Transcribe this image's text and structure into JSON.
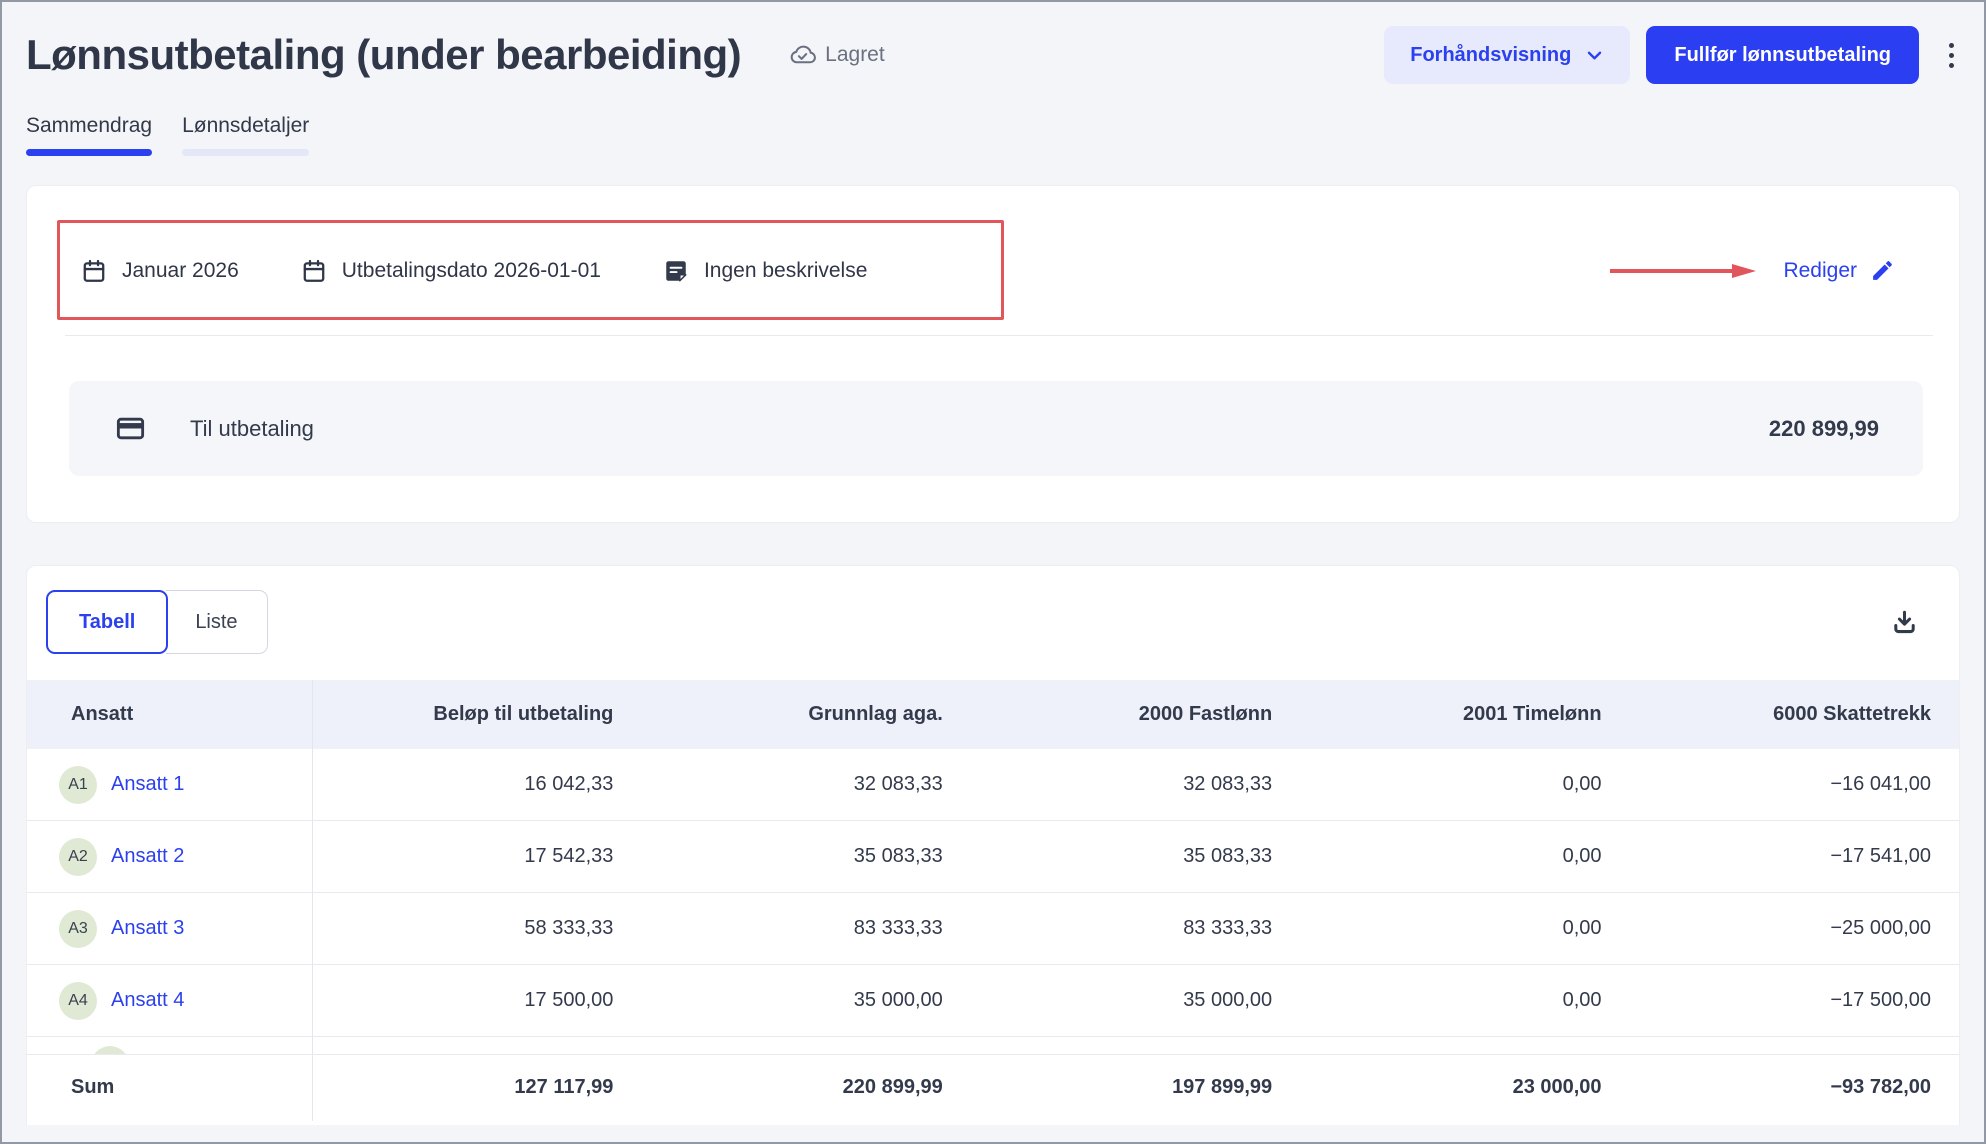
{
  "colors": {
    "accent_blue": "#2b40ee",
    "button_blue": "#2b3ef2",
    "annotation_red": "#e0565b",
    "avatar_green": "#dfe9d4",
    "header_row_bg": "#eef1fa",
    "page_bg": "#f4f5f9"
  },
  "header": {
    "title": "Lønnsutbetaling (under bearbeiding)",
    "saved_label": "Lagret",
    "preview_button_label": "Forhåndsvisning",
    "complete_button_label": "Fullfør lønnsutbetaling"
  },
  "tabs": {
    "summary": "Sammendrag",
    "details": "Lønnsdetaljer"
  },
  "period_card": {
    "period": "Januar 2026",
    "payment_date": "Utbetalingsdato 2026-01-01",
    "description": "Ingen beskrivelse",
    "edit_link": "Rediger",
    "payout_label": "Til utbetaling",
    "payout_amount": "220 899,99"
  },
  "table_card": {
    "toggle": {
      "table": "Tabell",
      "list": "Liste"
    },
    "columns": [
      "Ansatt",
      "Beløp til utbetaling",
      "Grunnlag aga.",
      "2000 Fastlønn",
      "2001 Timelønn",
      "6000 Skattetrekk"
    ],
    "rows": [
      {
        "avatar": "A1",
        "name": "Ansatt 1",
        "values": [
          "16 042,33",
          "32 083,33",
          "32 083,33",
          "0,00",
          "−16 041,00"
        ]
      },
      {
        "avatar": "A2",
        "name": "Ansatt 2",
        "values": [
          "17 542,33",
          "35 083,33",
          "35 083,33",
          "0,00",
          "−17 541,00"
        ]
      },
      {
        "avatar": "A3",
        "name": "Ansatt 3",
        "values": [
          "58 333,33",
          "83 333,33",
          "83 333,33",
          "0,00",
          "−25 000,00"
        ]
      },
      {
        "avatar": "A4",
        "name": "Ansatt 4",
        "values": [
          "17 500,00",
          "35 000,00",
          "35 000,00",
          "0,00",
          "−17 500,00"
        ]
      }
    ],
    "sum_row": {
      "label": "Sum",
      "values": [
        "127 117,99",
        "220 899,99",
        "197 899,99",
        "23 000,00",
        "−93 782,00"
      ]
    }
  }
}
